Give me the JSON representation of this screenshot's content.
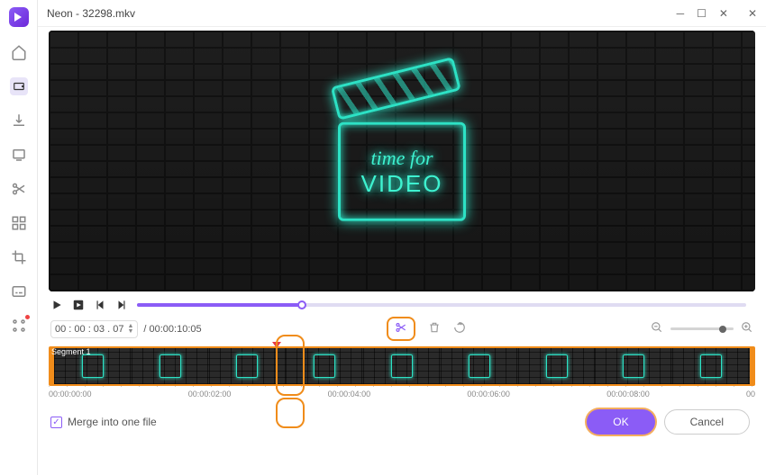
{
  "titlebar": {
    "title": "Neon - 32298.mkv"
  },
  "preview": {
    "text_top": "time for",
    "text_bottom": "VIDEO"
  },
  "time": {
    "current": "00 : 00 : 03 . 07",
    "total": "/ 00:00:10:05",
    "segment_label": "Segment 1"
  },
  "ruler": {
    "ticks": [
      "00:00:00:00",
      "00:00:02:00",
      "00:00:04:00",
      "00:00:06:00",
      "00:00:08:00",
      "00"
    ]
  },
  "bottom": {
    "merge_label": "Merge into one file",
    "ok": "OK",
    "cancel": "Cancel"
  },
  "icons": {
    "home": "home-icon",
    "convert": "convert-icon",
    "download": "download-icon",
    "square": "square-icon",
    "cut": "scissors-icon",
    "grid": "grid-icon",
    "crop": "crop-icon",
    "subtitle": "subtitle-icon",
    "apps": "apps-icon"
  }
}
